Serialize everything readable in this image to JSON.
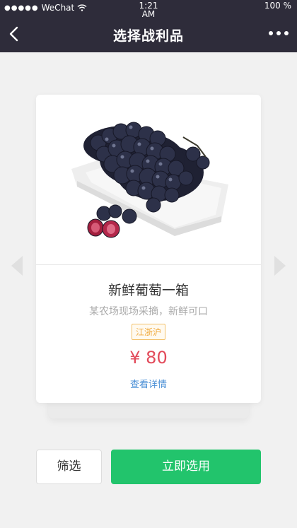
{
  "status_bar": {
    "carrier": "WeChat",
    "time": "1:21 AM",
    "battery": "100 %"
  },
  "nav": {
    "title": "选择战利品"
  },
  "product": {
    "name": "新鲜葡萄一箱",
    "description": "某农场现场采摘，新鲜可口",
    "region_tag": "江浙沪",
    "price": "¥ 80",
    "detail_link": "查看详情"
  },
  "actions": {
    "filter_label": "筛选",
    "select_label": "立即选用"
  },
  "colors": {
    "nav_bg": "#2e2c3a",
    "accent_green": "#22c46c",
    "price_red": "#e24a5a",
    "tag_orange": "#f0a83a",
    "link_blue": "#4a8fd6"
  }
}
